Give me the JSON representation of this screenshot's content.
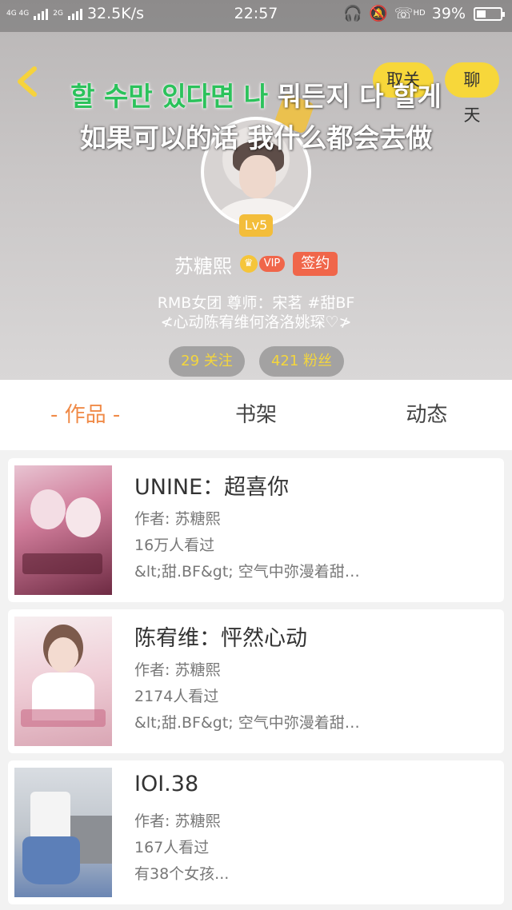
{
  "status_bar": {
    "network_left": "4G 4G",
    "network_right": "2G",
    "speed": "32.5K/s",
    "time": "22:57",
    "hd_label": "HD",
    "battery": "39%",
    "battery_level": 0.39
  },
  "header": {
    "back_icon": "chevron-left-icon",
    "follow_label": "取关",
    "chat_label": "聊天",
    "lyric_korean_highlight": "할 수만 있다면 나",
    "lyric_korean_rest": " 뭐든지 다 할게",
    "lyric_chinese": "如果可以的话 我什么都会去做",
    "level": "Lv5",
    "username": "苏糖熙",
    "vip_label": "VIP",
    "contract_label": "签约",
    "bio_line1": "RMB女团 尊师：宋茗 #甜BF",
    "bio_line2": "≮心动陈宥维何洛洛姚琛♡≯",
    "following": "29 关注",
    "fans": "421 粉丝"
  },
  "tabs": [
    {
      "label": "- 作品 -",
      "active": true
    },
    {
      "label": "书架",
      "active": false
    },
    {
      "label": "动态",
      "active": false
    }
  ],
  "books": [
    {
      "title": "UNINE：超喜你",
      "author": "作者: 苏糖熙",
      "views": "16万人看过",
      "desc": "&lt;甜.BF&gt; 空气中弥漫着甜…"
    },
    {
      "title": "陈宥维：怦然心动",
      "author": "作者: 苏糖熙",
      "views": "2174人看过",
      "desc": "&lt;甜.BF&gt; 空气中弥漫着甜…"
    },
    {
      "title": "IOI.38",
      "author": "作者: 苏糖熙",
      "views": "167人看过",
      "desc": "有38个女孩..."
    }
  ],
  "colors": {
    "accent_yellow": "#f7d73a",
    "tab_active": "#f08a47",
    "badge_red": "#f0664a",
    "lyric_green": "#2bc25b"
  }
}
